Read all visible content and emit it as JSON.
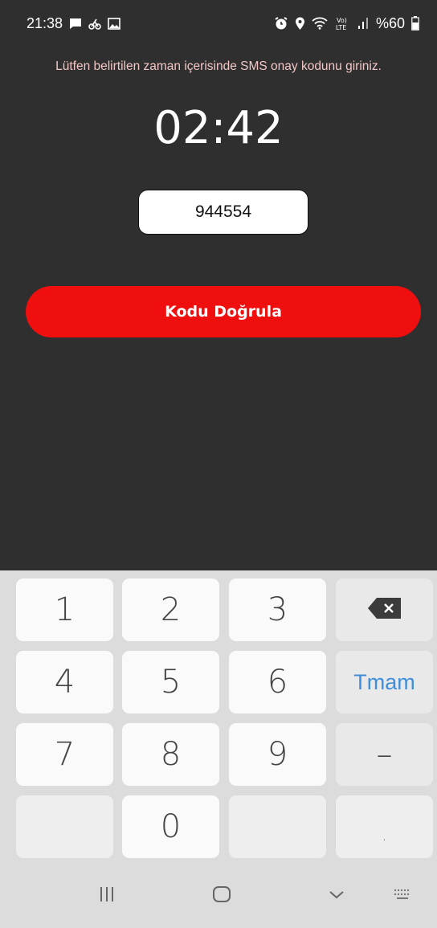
{
  "status_bar": {
    "time": "21:38",
    "battery_text": "%60",
    "left_icons": [
      "chat-icon",
      "bike-icon",
      "gallery-icon"
    ],
    "right_icons": [
      "alarm-icon",
      "location-icon",
      "wifi-icon",
      "volte-icon",
      "signal-icon",
      "battery-icon"
    ]
  },
  "screen": {
    "instruction": "Lütfen belirtilen zaman içerisinde SMS onay kodunu giriniz.",
    "timer": "02:42",
    "code_value": "944554",
    "verify_button": "Kodu Doğrula",
    "colors": {
      "background": "#2f2f2f",
      "accent": "#ef0f0f",
      "instruction_text": "#f3c6c6"
    }
  },
  "keyboard": {
    "keys": {
      "k1": "1",
      "k2": "2",
      "k3": "3",
      "k4": "4",
      "k5": "5",
      "k6": "6",
      "k7": "7",
      "k8": "8",
      "k9": "9",
      "k0": "0"
    },
    "backspace_icon": "backspace-icon",
    "done_label": "Tmam",
    "dash_label": "–",
    "comma_label": ",",
    "done_color": "#3f8edb"
  },
  "nav_bar": {
    "icons": [
      "recent-apps-icon",
      "home-icon",
      "back-icon",
      "keyboard-toggle-icon"
    ]
  }
}
